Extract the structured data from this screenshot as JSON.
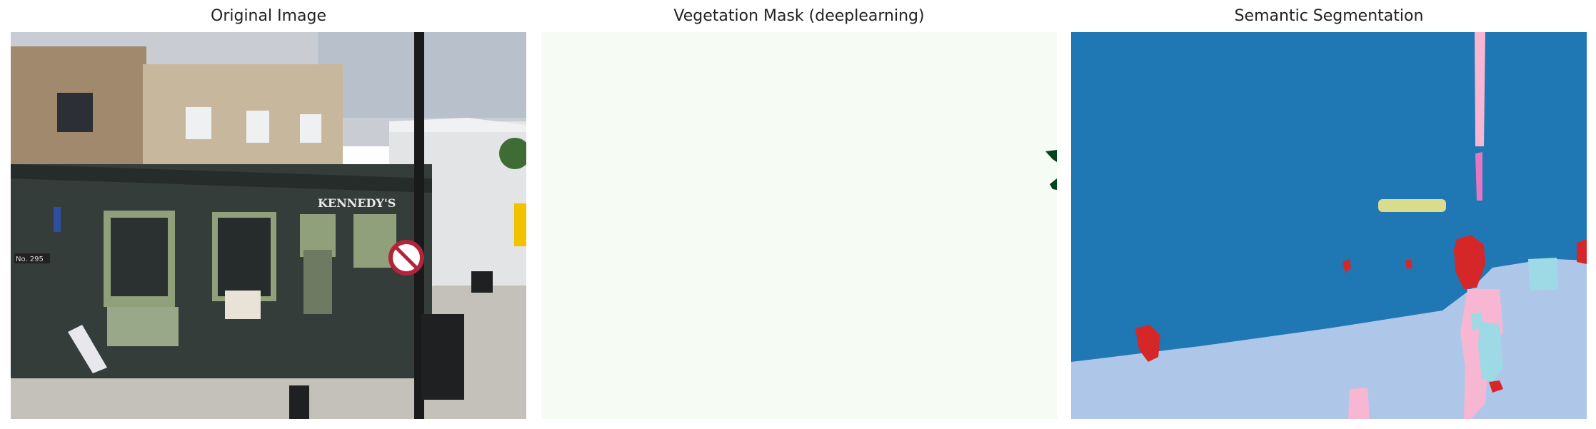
{
  "figure": {
    "panels": [
      {
        "title": "Original Image"
      },
      {
        "title": "Vegetation Mask (deeplearning)"
      },
      {
        "title": "Semantic Segmentation"
      }
    ]
  },
  "photo": {
    "shop_sign": "KENNEDY'S",
    "street_number": "No. 295"
  },
  "colors": {
    "sky_blue": "#1f77b4",
    "ground_light_blue": "#aec7e8",
    "red": "#d62728",
    "pink": "#f7b6d2",
    "magenta": "#e377c2",
    "yellow": "#dbdb8d",
    "cyan": "#9edae5",
    "vegetation_bg": "#f6fbf4",
    "vegetation_fg": "#00441b"
  }
}
